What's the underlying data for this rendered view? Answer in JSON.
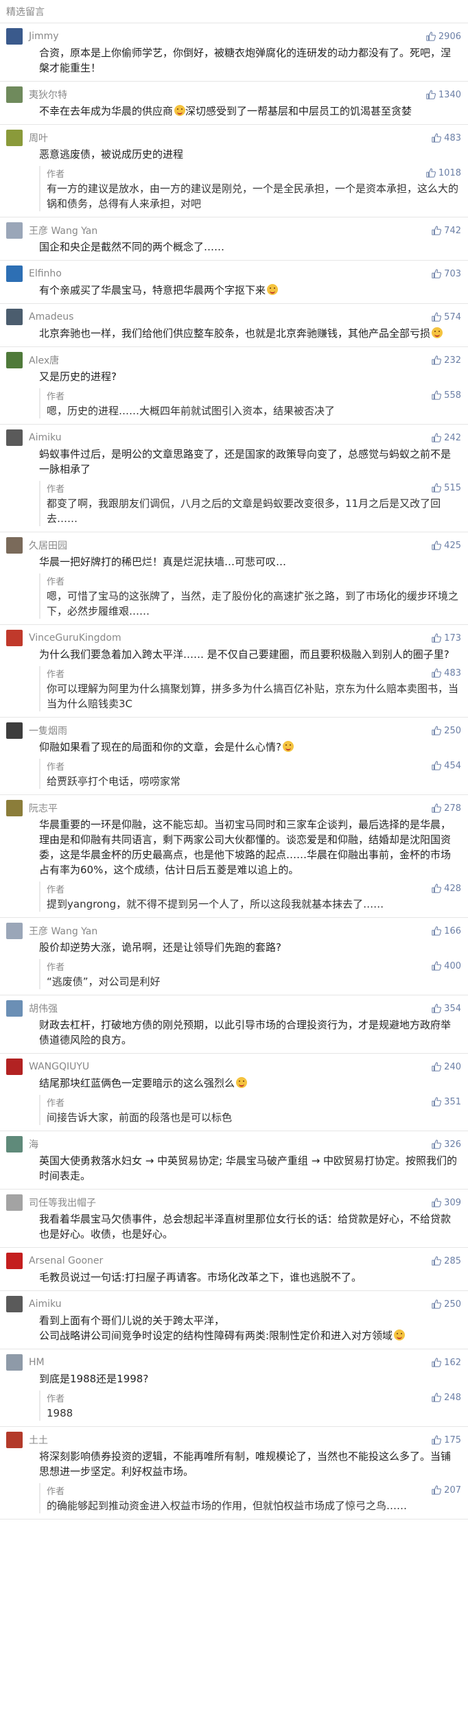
{
  "header": {
    "title": "精选留言"
  },
  "labels": {
    "author": "作者"
  },
  "colors": {
    "likes": "#6b7fa6",
    "divider": "#e6e6e6"
  },
  "comments": [
    {
      "nick": "Jimmy",
      "avatar_color": "#3a5a8c",
      "likes": "2906",
      "text": "合资，原本是上你偷师学艺，你倒好，被糖衣炮弹腐化的连研发的动力都没有了。死吧，涅槃才能重生！"
    },
    {
      "nick": "夷狄尔特",
      "avatar_color": "#6f8a5c",
      "likes": "1340",
      "text": "不幸在去年成为华晨的供应商",
      "emoji": true,
      "text2": "深切感受到了一帮基层和中层员工的饥渴甚至贪婪"
    },
    {
      "nick": "周叶",
      "avatar_color": "#8a9a3a",
      "likes": "483",
      "text": "恶意逃废债，被说成历史的进程",
      "reply": {
        "likes": "1018",
        "text": "有一方的建议是放水，由一方的建议是刚兑，一个是全民承担，一个是资本承担，这么大的锅和债务，总得有人来承担，对吧"
      }
    },
    {
      "nick": "王彦 Wang Yan",
      "avatar_color": "#9aa6b8",
      "likes": "742",
      "text": "国企和央企是截然不同的两个概念了……"
    },
    {
      "nick": "Elfinho",
      "avatar_color": "#2d6fb4",
      "likes": "703",
      "text": "有个亲戚买了华晨宝马，特意把华晨两个字抠下来",
      "emoji": true,
      "text2": ""
    },
    {
      "nick": "Amadeus",
      "avatar_color": "#4b5d6e",
      "likes": "574",
      "text": "北京奔驰也一样，我们给他们供应整车胶条，也就是北京奔驰赚钱，其他产品全部亏损",
      "emoji": true,
      "text2": ""
    },
    {
      "nick": "Alex唐",
      "avatar_color": "#4f7a3a",
      "likes": "232",
      "text": "又是历史的进程?",
      "reply": {
        "likes": "558",
        "text": "嗯，历史的进程……大概四年前就试图引入资本，结果被否决了"
      }
    },
    {
      "nick": "Aimiku",
      "avatar_color": "#5a5a5a",
      "likes": "242",
      "text": "蚂蚁事件过后，是明公的文章思路变了，还是国家的政策导向变了，总感觉与蚂蚁之前不是一脉相承了",
      "reply": {
        "likes": "515",
        "text": "都变了啊，我跟朋友们调侃，八月之后的文章是蚂蚁要改变很多，11月之后是又改了回去……"
      }
    },
    {
      "nick": "久居田园",
      "avatar_color": "#7a6a5a",
      "likes": "425",
      "text": "华晨一把好牌打的稀巴烂！真是烂泥扶墙…可悲可叹…",
      "reply": {
        "likes": "",
        "text": "嗯，可惜了宝马的这张牌了，当然，走了股份化的高速扩张之路，到了市场化的缓步环境之下，必然步履维艰……"
      }
    },
    {
      "nick": "VinceGuruKingdom",
      "avatar_color": "#c0392b",
      "likes": "173",
      "text": "为什么我们要急着加入跨太平洋…… 是不仅自己要建圈，而且要积极融入到别人的圈子里?",
      "reply": {
        "likes": "483",
        "text": "你可以理解为阿里为什么搞聚划算，拼多多为什么搞百亿补贴，京东为什么赔本卖图书，当当为什么赔钱卖3C"
      }
    },
    {
      "nick": "一隻烟雨",
      "avatar_color": "#3d3d3d",
      "likes": "250",
      "text": "仰融如果看了现在的局面和你的文章，会是什么心情?",
      "emoji": true,
      "text2": "",
      "reply": {
        "likes": "454",
        "text": "给贾跃亭打个电话，唠唠家常"
      }
    },
    {
      "nick": "阮志平",
      "avatar_color": "#8b7d3a",
      "likes": "278",
      "text": "华晨重要的一环是仰融，这不能忘却。当初宝马同时和三家车企谈判，最后选择的是华晨，理由是和仰融有共同语言，剩下两家公司大伙都懂的。谈恋爱是和仰融，结婚却是沈阳国资委，这是华晨金杯的历史最高点，也是他下坡路的起点……华晨在仰融出事前，金杯的市场占有率为60%，这个成绩，估计日后五菱是难以追上的。",
      "reply": {
        "likes": "428",
        "text": "提到yangrong，就不得不提到另一个人了，所以这段我就基本抹去了……"
      }
    },
    {
      "nick": "王彦 Wang Yan",
      "avatar_color": "#9aa6b8",
      "likes": "166",
      "text": "股价却逆势大涨，诡吊啊，还是让领导们先跑的套路?",
      "reply": {
        "likes": "400",
        "text": "“逃废债”，对公司是利好"
      }
    },
    {
      "nick": "胡伟强",
      "avatar_color": "#6b8fb5",
      "likes": "354",
      "text": "财政去杠杆，打破地方债的刚兑预期，以此引导市场的合理投资行为，才是规避地方政府举债道德风险的良方。"
    },
    {
      "nick": "WANGQIUYU",
      "avatar_color": "#b22222",
      "likes": "240",
      "text": "结尾那块红蓝俩色一定要暗示的这么强烈么",
      "emoji": true,
      "text2": "",
      "reply": {
        "likes": "351",
        "text": "间接告诉大家，前面的段落也是可以标色"
      }
    },
    {
      "nick": "海",
      "avatar_color": "#5f8a7a",
      "likes": "326",
      "text": "英国大使勇救落水妇女 → 中英贸易协定; 华晨宝马破产重组 → 中欧贸易打协定。按照我们的时间表走。"
    },
    {
      "nick": "司任等我出帽子",
      "avatar_color": "#a3a3a3",
      "likes": "309",
      "text": "我看着华晨宝马欠债事件，总会想起半泽直树里那位女行长的话：给贷款是好心，不给贷款也是好心。收债，也是好心。"
    },
    {
      "nick": "Arsenal Gooner",
      "avatar_color": "#c41e1e",
      "likes": "285",
      "text": "毛教员说过一句话:打扫屋子再请客。市场化改革之下，谁也逃脱不了。"
    },
    {
      "nick": "Aimiku",
      "avatar_color": "#5a5a5a",
      "likes": "250",
      "text": "看到上面有个哥们儿说的关于跨太平洋，",
      "text3": "公司战略讲公司间竞争时设定的结构性障碍有两类:限制性定价和进入对方领域",
      "emoji": true
    },
    {
      "nick": "HM",
      "avatar_color": "#8e9aa8",
      "likes": "162",
      "text": "到底是1988还是1998?",
      "reply": {
        "likes": "248",
        "text": "1988"
      }
    },
    {
      "nick": "土土",
      "avatar_color": "#b33a2a",
      "likes": "175",
      "text": "将深刻影响债券投资的逻辑，不能再唯所有制，唯规模论了，当然也不能投这么多了。当铺思想进一步坚定。利好权益市场。",
      "reply": {
        "likes": "207",
        "text": "的确能够起到推动资金进入权益市场的作用，但就怕权益市场成了惊弓之鸟……"
      }
    }
  ]
}
